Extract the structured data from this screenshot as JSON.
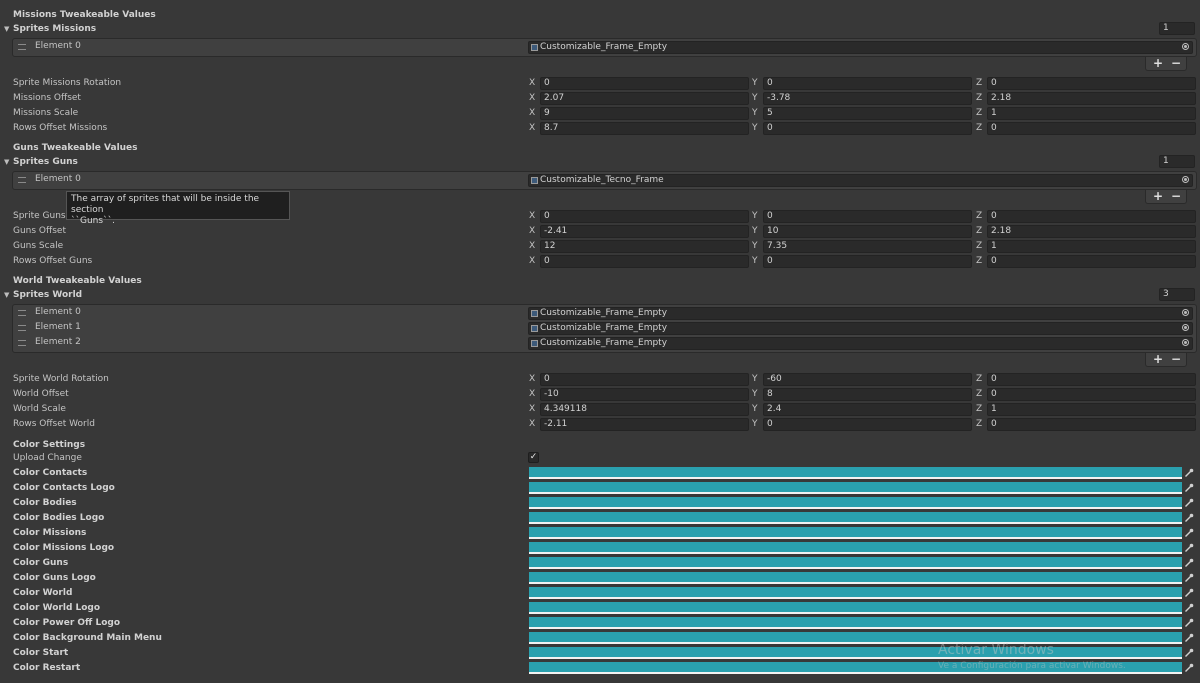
{
  "missions": {
    "header": "Missions Tweakeable Values",
    "sprites_label": "Sprites Missions",
    "size": "1",
    "elements": [
      {
        "label": "Element 0",
        "value": "Customizable_Frame_Empty"
      }
    ],
    "props": [
      {
        "label": "Sprite Missions Rotation",
        "x": "0",
        "y": "0",
        "z": "0"
      },
      {
        "label": "Missions Offset",
        "x": "2.07",
        "y": "-3.78",
        "z": "2.18"
      },
      {
        "label": "Missions Scale",
        "x": "9",
        "y": "5",
        "z": "1"
      },
      {
        "label": "Rows Offset Missions",
        "x": "8.7",
        "y": "0",
        "z": "0"
      }
    ]
  },
  "guns": {
    "header": "Guns Tweakeable Values",
    "sprites_label": "Sprites Guns",
    "size": "1",
    "elements": [
      {
        "label": "Element 0",
        "value": "Customizable_Tecno_Frame"
      }
    ],
    "props": [
      {
        "label": "Sprite Guns R",
        "x": "0",
        "y": "0",
        "z": "0"
      },
      {
        "label": "Guns Offset",
        "x": "-2.41",
        "y": "10",
        "z": "2.18"
      },
      {
        "label": "Guns Scale",
        "x": "12",
        "y": "7.35",
        "z": "1"
      },
      {
        "label": "Rows Offset Guns",
        "x": "0",
        "y": "0",
        "z": "0"
      }
    ],
    "tooltip_line1": "The array of sprites that will be inside the section",
    "tooltip_line2": "``Guns``."
  },
  "world": {
    "header": "World Tweakeable Values",
    "sprites_label": "Sprites World",
    "size": "3",
    "elements": [
      {
        "label": "Element 0",
        "value": "Customizable_Frame_Empty"
      },
      {
        "label": "Element 1",
        "value": "Customizable_Frame_Empty"
      },
      {
        "label": "Element 2",
        "value": "Customizable_Frame_Empty"
      }
    ],
    "props": [
      {
        "label": "Sprite World Rotation",
        "x": "0",
        "y": "-60",
        "z": "0"
      },
      {
        "label": "World Offset",
        "x": "-10",
        "y": "8",
        "z": "0"
      },
      {
        "label": "World Scale",
        "x": "4.349118",
        "y": "2.4",
        "z": "1"
      },
      {
        "label": "Rows Offset World",
        "x": "-2.11",
        "y": "0",
        "z": "0"
      }
    ]
  },
  "axis": {
    "x": "X",
    "y": "Y",
    "z": "Z"
  },
  "list_buttons": {
    "add": "+",
    "remove": "−"
  },
  "color_settings": {
    "header": "Color Settings",
    "upload_label": "Upload Change",
    "upload_checked": true,
    "swatch_color": "#2aa0ae",
    "colors": [
      "Color Contacts",
      "Color Contacts Logo",
      "Color Bodies",
      "Color Bodies Logo",
      "Color Missions",
      "Color Missions Logo",
      "Color Guns",
      "Color Guns Logo",
      "Color World",
      "Color World Logo",
      "Color Power Off Logo",
      "Color Background Main Menu",
      "Color Start",
      "Color Restart"
    ]
  },
  "watermark": {
    "title": "Activar Windows",
    "subtitle": "Ve a Configuración para activar Windows."
  }
}
